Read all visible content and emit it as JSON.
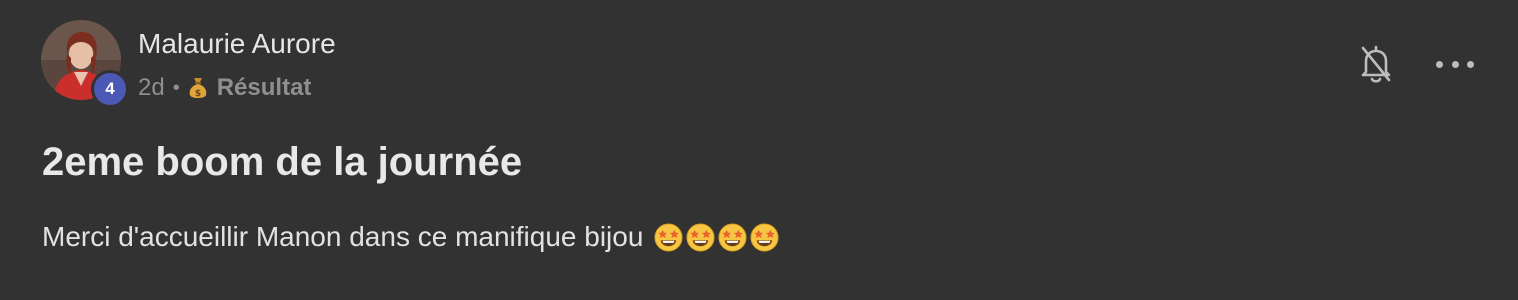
{
  "post": {
    "author": "Malaurie Aurore",
    "level": "4",
    "time": "2d",
    "separator": "•",
    "category_icon": "moneybag-icon",
    "category": "Résultat",
    "title": "2eme boom de la journée",
    "body": "Merci d'accueillir Manon dans ce manifique bijou",
    "emojis": [
      "star-struck-emoji-icon",
      "star-struck-emoji-icon",
      "star-struck-emoji-icon",
      "star-struck-emoji-icon"
    ]
  },
  "actions": {
    "notifications_icon": "bell-off-icon",
    "more_icon": "more-horizontal-icon"
  },
  "colors": {
    "background": "#323232",
    "level_badge": "#4b59b5",
    "text_primary": "#e8e8e8",
    "text_muted": "#8f8f8f"
  }
}
